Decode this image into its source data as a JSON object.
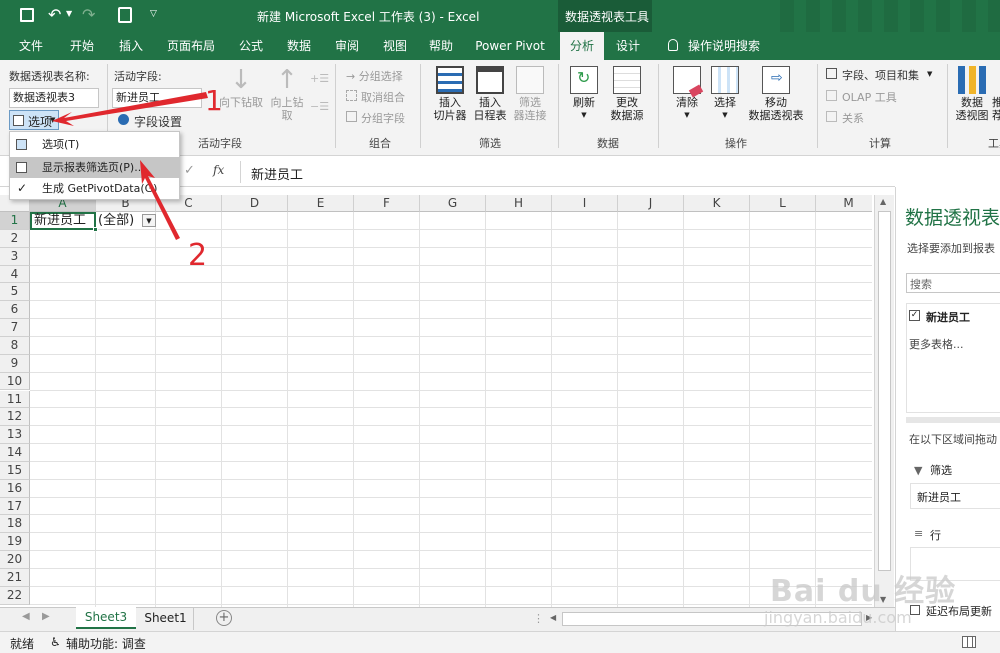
{
  "titlebar": {
    "title": "新建 Microsoft Excel 工作表 (3)  -  Excel",
    "context_title": "数据透视表工具"
  },
  "tabs": [
    {
      "label": "文件"
    },
    {
      "label": "开始"
    },
    {
      "label": "插入"
    },
    {
      "label": "页面布局"
    },
    {
      "label": "公式"
    },
    {
      "label": "数据"
    },
    {
      "label": "审阅"
    },
    {
      "label": "视图"
    },
    {
      "label": "帮助"
    },
    {
      "label": "Power Pivot"
    },
    {
      "label": "分析"
    },
    {
      "label": "设计"
    },
    {
      "label": "操作说明搜索"
    }
  ],
  "ribbon": {
    "pivot_name_label": "数据透视表名称:",
    "pivot_name_value": "数据透视表3",
    "options_label": "选项",
    "active_field_label": "活动字段:",
    "active_field_value": "新进员工",
    "field_settings": "字段设置",
    "drill_down": "向下钻取",
    "drill_up_1": "向上钻",
    "drill_up_2": "取",
    "group_active_field": "活动字段",
    "group_selection": "→ 分组选择",
    "ungroup": "取消组合",
    "group_field": "分组字段",
    "group_combine": "组合",
    "insert_slicer_1": "插入",
    "insert_slicer_2": "切片器",
    "insert_timeline_1": "插入",
    "insert_timeline_2": "日程表",
    "filter_conn_1": "筛选",
    "filter_conn_2": "器连接",
    "group_filter": "筛选",
    "refresh": "刷新",
    "change_source_1": "更改",
    "change_source_2": "数据源",
    "group_data": "数据",
    "clear": "清除",
    "select": "选择",
    "move_1": "移动",
    "move_2": "数据透视表",
    "group_actions": "操作",
    "fields_items_sets": "字段、项目和集",
    "olap_tools": "OLAP 工具",
    "relationships": "关系",
    "group_calc": "计算",
    "pivot_chart_1": "数据",
    "pivot_chart_2": "透视图",
    "tools_partial": "工具",
    "partial_btn_1": "推",
    "partial_btn_2": "荐"
  },
  "dropdown_menu": {
    "items": [
      {
        "label": "选项(T)"
      },
      {
        "label": "显示报表筛选页(P)..."
      },
      {
        "label": "生成 GetPivotData(G)"
      }
    ]
  },
  "formula_bar": {
    "fx": "fx",
    "content": "新进员工"
  },
  "sheet": {
    "columns": [
      "A",
      "B",
      "C",
      "D",
      "E",
      "F",
      "G",
      "H",
      "I",
      "J",
      "K",
      "L",
      "M"
    ],
    "rows": [
      "1",
      "2",
      "3",
      "4",
      "5",
      "6",
      "7",
      "8",
      "9",
      "10",
      "11",
      "12",
      "13",
      "14",
      "15",
      "16",
      "17",
      "18",
      "19",
      "20",
      "21",
      "22"
    ],
    "cell_a1": "新进员工",
    "cell_b1": "(全部)"
  },
  "sheet_tabs": [
    {
      "label": "Sheet3",
      "active": true
    },
    {
      "label": "Sheet1",
      "active": false
    }
  ],
  "status": {
    "ready": "就绪",
    "accessibility": "辅助功能: 调查"
  },
  "pane": {
    "title": "数据透视表",
    "subtitle": "选择要添加到报表",
    "search_placeholder": "搜索",
    "field": "新进员工",
    "more_tables": "更多表格...",
    "drag_hint": "在以下区域间拖动",
    "filters_label": "筛选",
    "filters_item": "新进员工",
    "rows_label": "行",
    "defer_update": "延迟布局更新"
  },
  "annotations": {
    "num1": "1",
    "num2": "2"
  },
  "watermark": {
    "logo": "Bai du 经验",
    "url": "jingyan.baidu.com"
  },
  "colors": {
    "excel_green": "#217346",
    "arrow_red": "#e0282e"
  }
}
